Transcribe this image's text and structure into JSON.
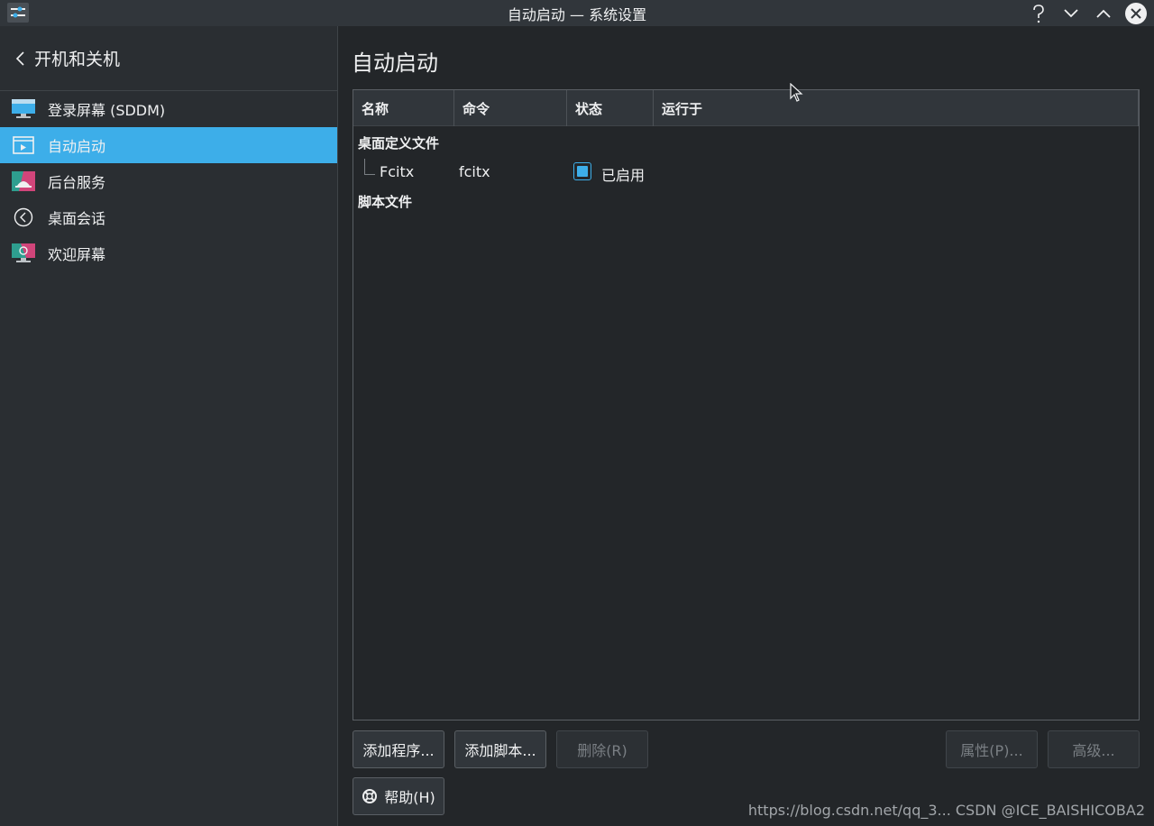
{
  "window": {
    "title": "自动启动 — 系统设置"
  },
  "sidebar": {
    "back_label": "开机和关机",
    "items": [
      {
        "label": "登录屏幕 (SDDM)",
        "icon": "monitor-icon"
      },
      {
        "label": "自动启动",
        "icon": "autostart-icon",
        "active": true
      },
      {
        "label": "后台服务",
        "icon": "services-icon"
      },
      {
        "label": "桌面会话",
        "icon": "session-icon"
      },
      {
        "label": "欢迎屏幕",
        "icon": "splash-icon"
      }
    ]
  },
  "main": {
    "title": "自动启动",
    "columns": [
      "名称",
      "命令",
      "状态",
      "运行于"
    ],
    "groups": [
      {
        "label": "桌面定义文件",
        "rows": [
          {
            "name": "Fcitx",
            "command": "fcitx",
            "status": "已启用",
            "enabled": true
          }
        ]
      },
      {
        "label": "脚本文件",
        "rows": []
      }
    ]
  },
  "buttons": {
    "add_program": "添加程序...",
    "add_script": "添加脚本...",
    "remove": "删除(R)",
    "properties": "属性(P)...",
    "advanced": "高级...",
    "help": "帮助(H)"
  },
  "watermark": "https://blog.csdn.net/qq_3... CSDN @ICE_BAISHICOBA2",
  "colors": {
    "accent": "#3daee9",
    "background": "#232629",
    "sidebar": "#2a2e32",
    "titlebar": "#31363b"
  }
}
